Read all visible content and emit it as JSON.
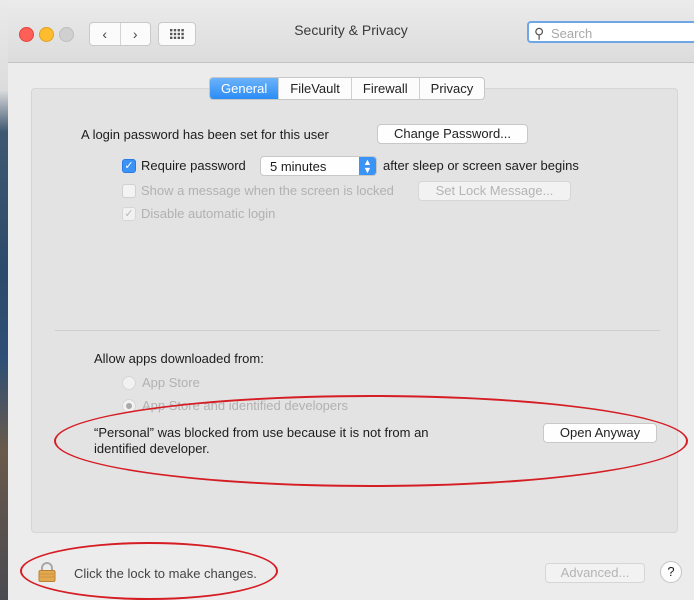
{
  "window": {
    "title": "Security & Privacy"
  },
  "search": {
    "placeholder": "Search"
  },
  "tabs": [
    {
      "label": "General",
      "active": true
    },
    {
      "label": "FileVault",
      "active": false
    },
    {
      "label": "Firewall",
      "active": false
    },
    {
      "label": "Privacy",
      "active": false
    }
  ],
  "general": {
    "login_password_text": "A login password has been set for this user",
    "change_password_button": "Change Password...",
    "require_password": {
      "label": "Require password",
      "checked": true,
      "value": "5 minutes",
      "suffix": "after sleep or screen saver begins"
    },
    "show_message": {
      "label": "Show a message when the screen is locked",
      "checked": false,
      "button": "Set Lock Message..."
    },
    "disable_auto_login": {
      "label": "Disable automatic login",
      "checked": true
    }
  },
  "downloads": {
    "heading": "Allow apps downloaded from:",
    "options": [
      {
        "label": "App Store",
        "selected": false
      },
      {
        "label": "App Store and identified developers",
        "selected": true
      }
    ],
    "blocked_message_line1": "“Personal” was blocked from use because it is not from an",
    "blocked_message_line2": "identified developer.",
    "open_anyway_button": "Open Anyway"
  },
  "footer": {
    "lock_text": "Click the lock to make changes.",
    "advanced_button": "Advanced...",
    "help_button": "?"
  },
  "colors": {
    "accent": "#2a8cf5",
    "annotation": "#d51d24"
  }
}
